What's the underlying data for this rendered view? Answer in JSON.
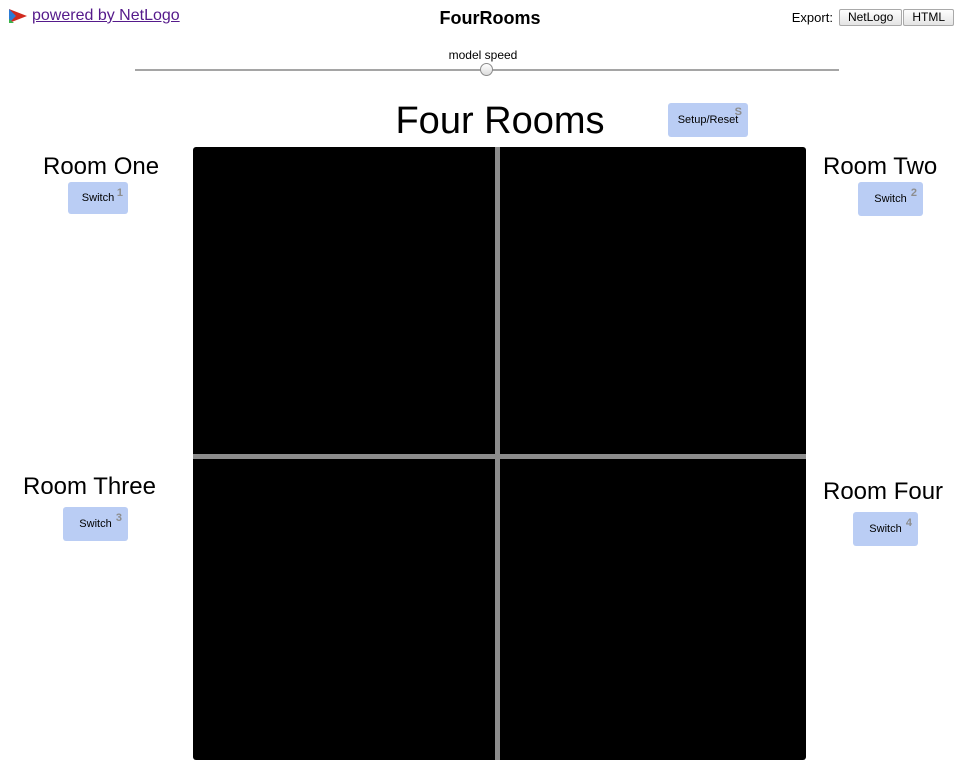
{
  "header": {
    "powered_link": "powered by NetLogo",
    "title": "FourRooms",
    "export_label": "Export:",
    "export_buttons": [
      "NetLogo",
      "HTML"
    ]
  },
  "speed": {
    "label": "model speed",
    "value": 0.5
  },
  "main_title": "Four Rooms",
  "setup_button": {
    "label": "Setup/Reset",
    "hotkey": "S"
  },
  "rooms": [
    {
      "label": "Room One",
      "button": "Switch",
      "hotkey": "1"
    },
    {
      "label": "Room Two",
      "button": "Switch",
      "hotkey": "2"
    },
    {
      "label": "Room Three",
      "button": "Switch",
      "hotkey": "3"
    },
    {
      "label": "Room Four",
      "button": "Switch",
      "hotkey": "4"
    }
  ],
  "colors": {
    "button_bg": "#bacdf4",
    "world_bg": "#000000",
    "wall": "#8c8c8c",
    "link": "#551a8b"
  }
}
